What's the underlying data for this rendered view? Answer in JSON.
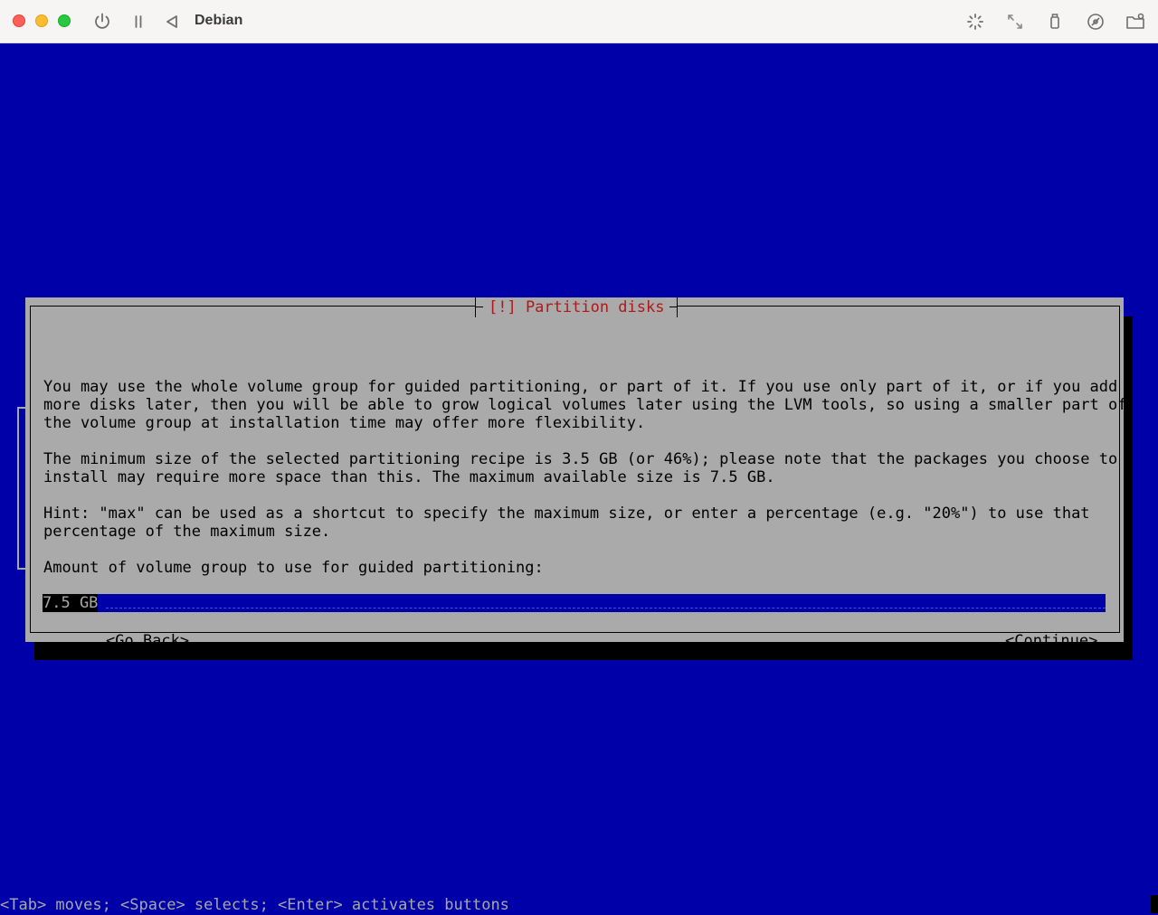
{
  "window": {
    "title": "Debian"
  },
  "toolbar": {
    "left_icons": [
      "power-icon",
      "pause-icon",
      "back-triangle-icon"
    ],
    "right_icons": [
      "brightness-icon",
      "resize-icon",
      "usb-icon",
      "cd-icon",
      "folder-share-icon"
    ]
  },
  "dialog": {
    "title": "[!] Partition disks",
    "paragraphs": [
      "You may use the whole volume group for guided partitioning, or part of it. If you use only part of it, or if you add\nmore disks later, then you will be able to grow logical volumes later using the LVM tools, so using a smaller part of\nthe volume group at installation time may offer more flexibility.",
      "The minimum size of the selected partitioning recipe is 3.5 GB (or 46%); please note that the packages you choose to\ninstall may require more space than this. The maximum available size is 7.5 GB.",
      "Hint: \"max\" can be used as a shortcut to specify the maximum size, or enter a percentage (e.g. \"20%\") to use that\npercentage of the maximum size.",
      "Amount of volume group to use for guided partitioning:"
    ],
    "input_value": "7.5 GB",
    "go_back_label": "<Go Back>",
    "continue_label": "<Continue>"
  },
  "status_line": "<Tab> moves; <Space> selects; <Enter> activates buttons",
  "colors": {
    "screen_bg": "#0000a8",
    "dialog_bg": "#aaaaaa",
    "title_text": "#b21818"
  }
}
